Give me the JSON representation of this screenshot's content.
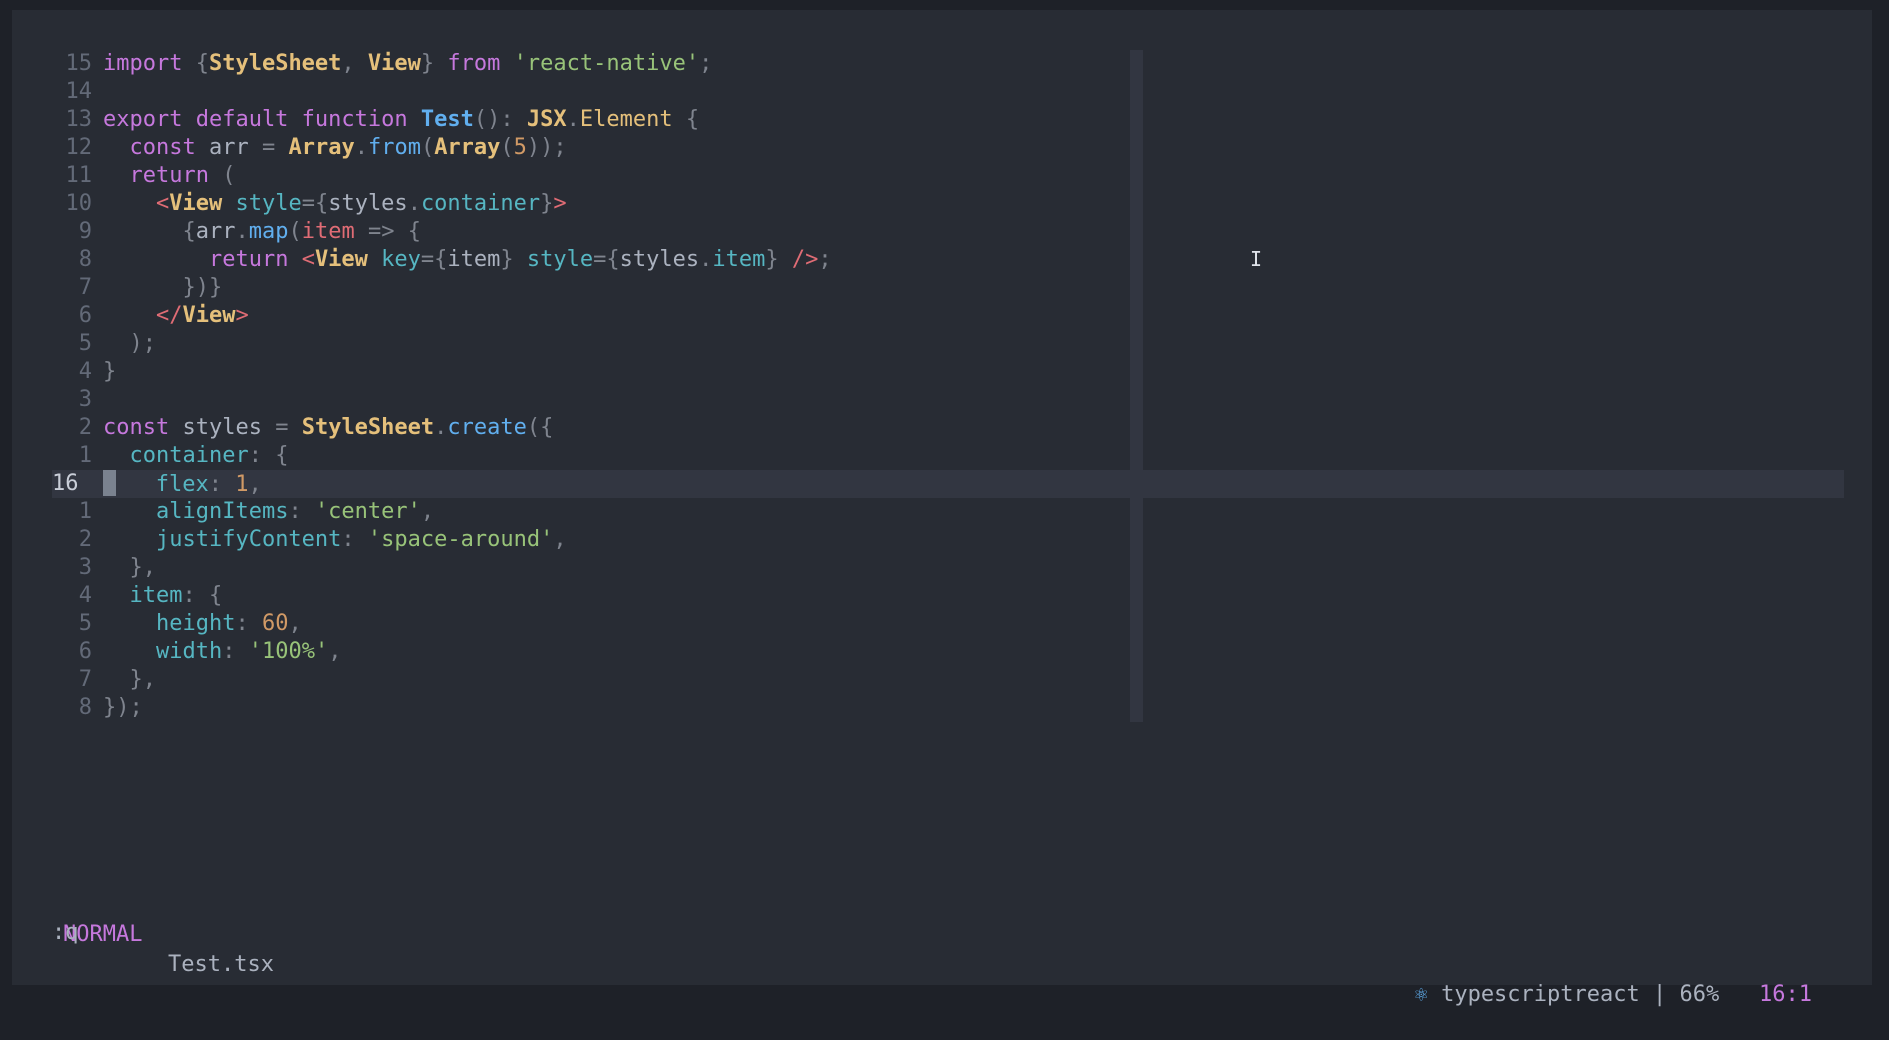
{
  "editor": {
    "lines": [
      {
        "num": "15",
        "tokens": [
          [
            "k",
            "import "
          ],
          [
            "d",
            "{"
          ],
          [
            "t",
            "StyleSheet"
          ],
          [
            "d",
            ", "
          ],
          [
            "t",
            "View"
          ],
          [
            "d",
            "} "
          ],
          [
            "k",
            "from "
          ],
          [
            "s",
            "'react-native'"
          ],
          [
            "d",
            ";"
          ]
        ]
      },
      {
        "num": "14",
        "tokens": []
      },
      {
        "num": "13",
        "tokens": [
          [
            "k",
            "export default function "
          ],
          [
            "fb",
            "Test"
          ],
          [
            "d",
            "(): "
          ],
          [
            "t",
            "JSX"
          ],
          [
            "d",
            "."
          ],
          [
            "ty",
            "Element"
          ],
          [
            "d",
            " {"
          ]
        ]
      },
      {
        "num": "12",
        "tokens": [
          [
            "d",
            "  "
          ],
          [
            "k",
            "const "
          ],
          [
            "",
            "arr "
          ],
          [
            "d",
            "= "
          ],
          [
            "t",
            "Array"
          ],
          [
            "d",
            "."
          ],
          [
            "f",
            "from"
          ],
          [
            "d",
            "("
          ],
          [
            "t",
            "Array"
          ],
          [
            "d",
            "("
          ],
          [
            "n",
            "5"
          ],
          [
            "d",
            "));"
          ]
        ]
      },
      {
        "num": "11",
        "tokens": [
          [
            "d",
            "  "
          ],
          [
            "k",
            "return "
          ],
          [
            "d",
            "("
          ]
        ]
      },
      {
        "num": "10",
        "tokens": [
          [
            "d",
            "    "
          ],
          [
            "r",
            "<"
          ],
          [
            "t",
            "View "
          ],
          [
            "p",
            "style"
          ],
          [
            "d",
            "={"
          ],
          [
            "",
            "styles"
          ],
          [
            "d",
            "."
          ],
          [
            "p",
            "container"
          ],
          [
            "d",
            "}"
          ],
          [
            "r",
            ">"
          ]
        ]
      },
      {
        "num": "9",
        "tokens": [
          [
            "d",
            "      {"
          ],
          [
            "",
            "arr"
          ],
          [
            "d",
            "."
          ],
          [
            "f",
            "map"
          ],
          [
            "d",
            "("
          ],
          [
            "r",
            "item "
          ],
          [
            "d",
            "=> {"
          ]
        ]
      },
      {
        "num": "8",
        "tokens": [
          [
            "d",
            "        "
          ],
          [
            "k",
            "return "
          ],
          [
            "r",
            "<"
          ],
          [
            "t",
            "View "
          ],
          [
            "p",
            "key"
          ],
          [
            "d",
            "={"
          ],
          [
            "",
            "item"
          ],
          [
            "d",
            "} "
          ],
          [
            "p",
            "style"
          ],
          [
            "d",
            "={"
          ],
          [
            "",
            "styles"
          ],
          [
            "d",
            "."
          ],
          [
            "p",
            "item"
          ],
          [
            "d",
            "} "
          ],
          [
            "r",
            "/>"
          ],
          [
            "d",
            ";"
          ]
        ]
      },
      {
        "num": "7",
        "tokens": [
          [
            "d",
            "      })}"
          ]
        ]
      },
      {
        "num": "6",
        "tokens": [
          [
            "d",
            "    "
          ],
          [
            "r",
            "</"
          ],
          [
            "t",
            "View"
          ],
          [
            "r",
            ">"
          ]
        ]
      },
      {
        "num": "5",
        "tokens": [
          [
            "d",
            "  );"
          ]
        ]
      },
      {
        "num": "4",
        "tokens": [
          [
            "d",
            "}"
          ]
        ]
      },
      {
        "num": "3",
        "tokens": []
      },
      {
        "num": "2",
        "tokens": [
          [
            "k",
            "const "
          ],
          [
            "",
            "styles "
          ],
          [
            "d",
            "= "
          ],
          [
            "t",
            "StyleSheet"
          ],
          [
            "d",
            "."
          ],
          [
            "f",
            "create"
          ],
          [
            "d",
            "({"
          ]
        ]
      },
      {
        "num": "1",
        "tokens": [
          [
            "d",
            "  "
          ],
          [
            "p",
            "container"
          ],
          [
            "d",
            ": {"
          ]
        ]
      },
      {
        "num": "16",
        "current": true,
        "tokens": [
          [
            "cursor",
            ""
          ],
          [
            "d",
            "   "
          ],
          [
            "p",
            "flex"
          ],
          [
            "d",
            ": "
          ],
          [
            "n",
            "1"
          ],
          [
            "d",
            ","
          ]
        ]
      },
      {
        "num": "1",
        "tokens": [
          [
            "d",
            "    "
          ],
          [
            "p",
            "alignItems"
          ],
          [
            "d",
            ": "
          ],
          [
            "s",
            "'center'"
          ],
          [
            "d",
            ","
          ]
        ]
      },
      {
        "num": "2",
        "tokens": [
          [
            "d",
            "    "
          ],
          [
            "p",
            "justifyContent"
          ],
          [
            "d",
            ": "
          ],
          [
            "s",
            "'space-around'"
          ],
          [
            "d",
            ","
          ]
        ]
      },
      {
        "num": "3",
        "tokens": [
          [
            "d",
            "  },"
          ]
        ]
      },
      {
        "num": "4",
        "tokens": [
          [
            "d",
            "  "
          ],
          [
            "p",
            "item"
          ],
          [
            "d",
            ": {"
          ]
        ]
      },
      {
        "num": "5",
        "tokens": [
          [
            "d",
            "    "
          ],
          [
            "p",
            "height"
          ],
          [
            "d",
            ": "
          ],
          [
            "n",
            "60"
          ],
          [
            "d",
            ","
          ]
        ]
      },
      {
        "num": "6",
        "tokens": [
          [
            "d",
            "    "
          ],
          [
            "p",
            "width"
          ],
          [
            "d",
            ": "
          ],
          [
            "s",
            "'100%'"
          ],
          [
            "d",
            ","
          ]
        ]
      },
      {
        "num": "7",
        "tokens": [
          [
            "d",
            "  },"
          ]
        ]
      },
      {
        "num": "8",
        "tokens": [
          [
            "d",
            "});"
          ]
        ]
      }
    ]
  },
  "statusline": {
    "mode": "NORMAL",
    "filename": "Test.tsx",
    "react_icon": "⚛",
    "filetype": "typescriptreact",
    "separator": "|",
    "percent": "66%",
    "position": "16:1"
  },
  "cmdline": {
    "text": ":q"
  },
  "mouse_cursor": {
    "icon": "text-cursor-icon",
    "glyph": "I"
  },
  "colors": {
    "background": "#282c34",
    "keyword": "#c678dd",
    "string": "#98c379",
    "type": "#e5c07b",
    "function": "#61afef",
    "property": "#56b6c2",
    "number": "#d19a66",
    "tag": "#e06c75"
  }
}
